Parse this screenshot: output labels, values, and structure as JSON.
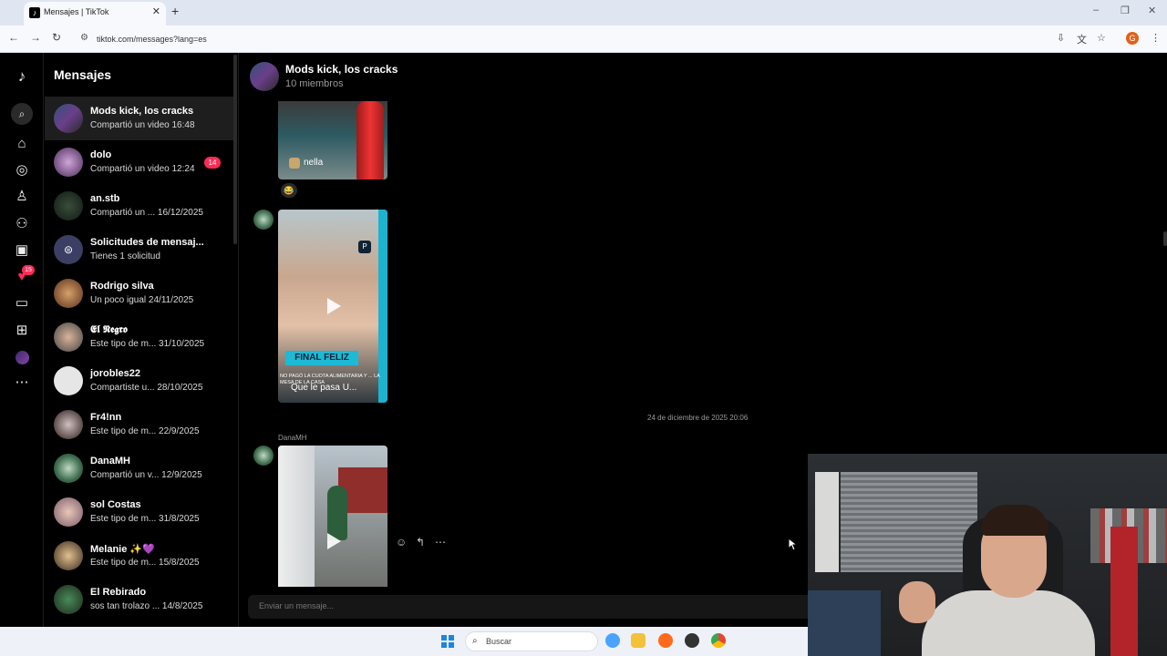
{
  "browser": {
    "tab_title": "Mensajes | TikTok",
    "tab_favicon": "♪",
    "url": "tiktok.com/messages?lang=es",
    "new_tab": "+",
    "tab_close": "✕",
    "window_controls": [
      "‒",
      "❐",
      "✕"
    ],
    "nav_icons": [
      "arrow-left-icon",
      "arrow-right-icon",
      "reload-icon",
      "site-info-icon"
    ],
    "nav_glyphs": [
      "←",
      "→",
      "↻",
      "⚙"
    ],
    "profile_initial": "G"
  },
  "rail": {
    "icons": [
      "tiktok-logo-icon",
      "search-icon",
      "home-icon",
      "explore-icon",
      "following-icon",
      "friends-icon",
      "live-icon",
      "activity-icon",
      "messages-icon",
      "upload-icon",
      "profile-avatar",
      "more-icon"
    ],
    "activity_badge": "15"
  },
  "sidebar": {
    "title": "Mensajes",
    "conversations": [
      {
        "name": "Mods kick, los cracks",
        "preview": "Compartió un video 16:48",
        "active": true
      },
      {
        "name": "dolo",
        "preview": "Compartió un video 12:24",
        "badge": "14"
      },
      {
        "name": "an.stb",
        "preview": "Compartió un ...  16/12/2025"
      },
      {
        "name": "Solicitudes de mensaj...",
        "preview": "Tienes 1 solicitud"
      },
      {
        "name": "Rodrigo silva",
        "preview": "Un poco igual  24/11/2025"
      },
      {
        "name": "𝕰𝖑 𝕹𝖊𝖌𝖗𝖔",
        "preview": "Este tipo de m...  31/10/2025"
      },
      {
        "name": "jorobles22",
        "preview": "Compartiste u...  28/10/2025"
      },
      {
        "name": "Fr4!nn",
        "preview": "Este tipo de m...  22/9/2025"
      },
      {
        "name": "DanaMH",
        "preview": "Compartió un v...  12/9/2025"
      },
      {
        "name": "sol Costas",
        "preview": "Este tipo de m...  31/8/2025"
      },
      {
        "name": "Melanie ✨💜",
        "preview": "Este tipo de m...  15/8/2025"
      },
      {
        "name": "El Rebirado",
        "preview": "sos tan trolazo ...  14/8/2025"
      }
    ]
  },
  "chat": {
    "title": "Mods kick, los cracks",
    "members": "10 miembros",
    "video1_user": "nella",
    "reaction": "😂",
    "video2_banner": "FINAL FELIZ",
    "video2_caption": "NO PAGÓ LA CUOTA ALIMENTARIA Y ... LA MESA DE LA CASA",
    "video2_title": "Que le pasa U...",
    "timestamp": "24 de diciembre de 2025 20:06",
    "sender_name": "DanaMH",
    "message_actions": [
      "☺",
      "↰",
      "⋯"
    ],
    "composer_placeholder": "Enviar un mensaje..."
  },
  "taskbar": {
    "search_label": "Buscar",
    "apps": [
      "copilot-icon",
      "file-explorer-icon",
      "firefox-icon",
      "obs-icon",
      "chrome-icon"
    ],
    "app_colors": [
      "#4aa3ff",
      "#f3c13a",
      "#ff6a1a",
      "#333333",
      "#3b82f6"
    ]
  },
  "colors": {
    "accent": "#fe2c55",
    "background": "#000000"
  }
}
